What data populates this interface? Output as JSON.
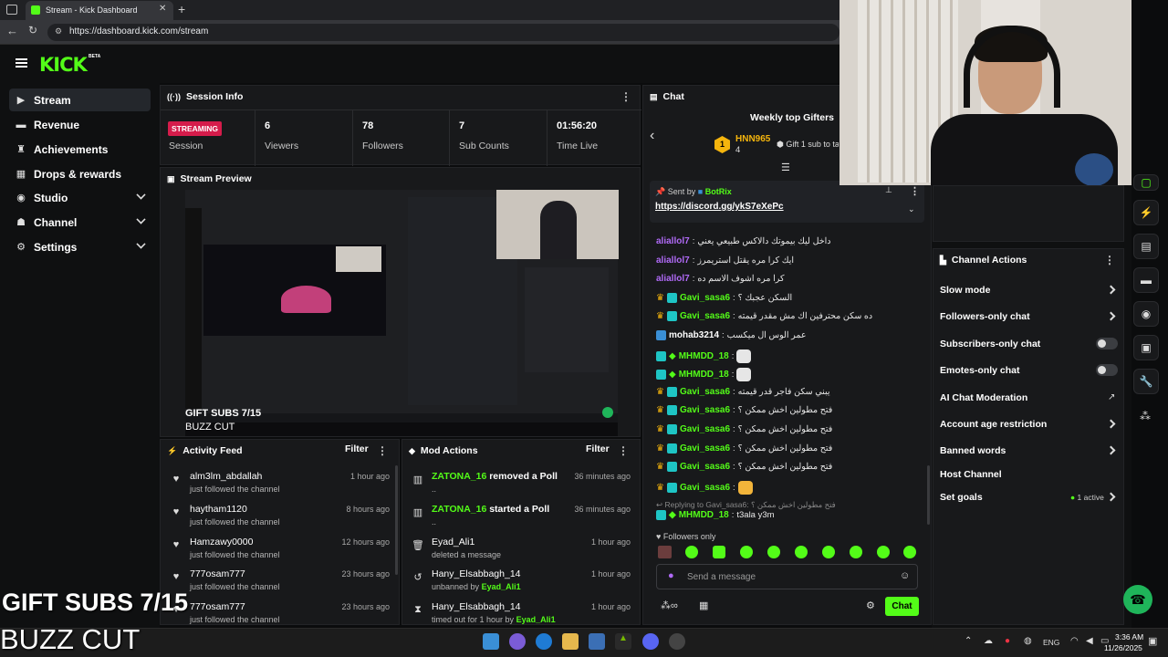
{
  "browser": {
    "tab_title": "Stream - Kick Dashboard",
    "url": "https://dashboard.kick.com/stream"
  },
  "header": {
    "logo": "KICK",
    "beta": "BETA"
  },
  "sidebar": {
    "items": [
      {
        "label": "Stream",
        "icon": "video-icon"
      },
      {
        "label": "Revenue",
        "icon": "money-icon"
      },
      {
        "label": "Achievements",
        "icon": "trophy-icon"
      },
      {
        "label": "Drops & rewards",
        "icon": "gift-icon"
      },
      {
        "label": "Studio",
        "icon": "studio-icon"
      },
      {
        "label": "Channel",
        "icon": "channel-icon"
      },
      {
        "label": "Settings",
        "icon": "gear-icon"
      }
    ]
  },
  "session": {
    "title": "Session Info",
    "status_badge": "STREAMING",
    "status_label": "Session",
    "stats": [
      {
        "value": "6",
        "label": "Viewers"
      },
      {
        "value": "78",
        "label": "Followers"
      },
      {
        "value": "7",
        "label": "Sub Counts"
      },
      {
        "value": "01:56:20",
        "label": "Time Live"
      }
    ]
  },
  "preview": {
    "title": "Stream Preview",
    "overlay_line1": "GIFT SUBS 7/15",
    "overlay_line2": "BUZZ CUT"
  },
  "activity": {
    "title": "Activity Feed",
    "filter": "Filter",
    "rows": [
      {
        "name": "alm3lm_abdallah",
        "sub": "just followed the channel",
        "time": "1 hour ago"
      },
      {
        "name": "haytham1120",
        "sub": "just followed the channel",
        "time": "8 hours ago"
      },
      {
        "name": "Hamzawy0000",
        "sub": "just followed the channel",
        "time": "12 hours ago"
      },
      {
        "name": "777osam777",
        "sub": "just followed the channel",
        "time": "23 hours ago"
      },
      {
        "name": "777osam777",
        "sub": "just followed the channel",
        "time": "23 hours ago"
      }
    ]
  },
  "mod": {
    "title": "Mod Actions",
    "filter": "Filter",
    "rows": [
      {
        "name": "ZATONA_16",
        "action": "removed a Poll",
        "sub": "..",
        "time": "36 minutes ago"
      },
      {
        "name": "ZATONA_16",
        "action": "started a Poll",
        "sub": "..",
        "time": "36 minutes ago"
      },
      {
        "name": "Eyad_Ali1",
        "action": "",
        "sub": "deleted a message",
        "time": "1 hour ago"
      },
      {
        "name": "Hany_Elsabbagh_14",
        "action": "",
        "sub": "unbanned by",
        "sub_user": "Eyad_Ali1",
        "time": "1 hour ago"
      },
      {
        "name": "Hany_Elsabbagh_14",
        "action": "",
        "sub": "timed out for 1 hour by",
        "sub_user": "Eyad_Ali1",
        "time": "1 hour ago"
      }
    ]
  },
  "chat": {
    "title": "Chat",
    "top_gifters_title": "Weekly top Gifters",
    "top_gifter": {
      "rank": "1",
      "name": "HNN965",
      "count": "4"
    },
    "gift_cta": "Gift 1 sub to ta",
    "pinned": {
      "sent_by": "Sent by",
      "user": "BotRix",
      "link": "https://discord.gg/ykS7eXePc"
    },
    "messages": [
      {
        "user": "aliallol7",
        "color": "pur",
        "text": "داخل ليك بيموتك دالاكس طبيعي يعني",
        "badges": []
      },
      {
        "user": "aliallol7",
        "color": "pur",
        "text": "ايك كرا مره يقتل استريمرز",
        "badges": []
      },
      {
        "user": "aliallol7",
        "color": "pur",
        "text": "كرا مره اشوف الاسم ده",
        "badges": []
      },
      {
        "user": "Gavi_sasa6",
        "color": "grn",
        "text": "السكن عجبك ؟",
        "badges": [
          "crown",
          "mod"
        ]
      },
      {
        "user": "Gavi_sasa6",
        "color": "grn",
        "text": "ده سكن محترفين اك مش مقدر قيمته",
        "badges": [
          "crown",
          "mod"
        ]
      },
      {
        "user": "mohab3214",
        "color": "wht",
        "text": "عمر الوس ال ميكسب",
        "badges": [
          "vip"
        ]
      },
      {
        "user": "MHMDD_18",
        "color": "grn",
        "text": "",
        "badges": [
          "mod",
          "diamond"
        ]
      },
      {
        "user": "MHMDD_18",
        "color": "grn",
        "text": "",
        "badges": [
          "mod",
          "diamond"
        ]
      },
      {
        "user": "Gavi_sasa6",
        "color": "grn",
        "text": "يبني سكن فاجر قدر قيمته",
        "badges": [
          "crown",
          "mod"
        ]
      },
      {
        "user": "Gavi_sasa6",
        "color": "grn",
        "text": "فتح مطولين اخش ممكن ؟",
        "badges": [
          "crown",
          "mod"
        ]
      },
      {
        "user": "Gavi_sasa6",
        "color": "grn",
        "text": "فتح مطولين اخش ممكن ؟",
        "badges": [
          "crown",
          "mod"
        ]
      },
      {
        "user": "Gavi_sasa6",
        "color": "grn",
        "text": "فتح مطولين اخش ممكن ؟",
        "badges": [
          "crown",
          "mod"
        ]
      },
      {
        "user": "Gavi_sasa6",
        "color": "grn",
        "text": "فتح مطولين اخش ممكن ؟",
        "badges": [
          "crown",
          "mod"
        ]
      },
      {
        "user": "Gavi_sasa6",
        "color": "grn",
        "text": "",
        "badges": [
          "crown",
          "mod"
        ]
      }
    ],
    "reply_to": "Replying to Gavi_sasa6:",
    "reply_text": "فتح مطولين اخش ممكن ؟",
    "reply_user": "MHMDD_18",
    "reply_msg": "t3ala y3m",
    "followers_only": "Followers only",
    "input_placeholder": "Send a message",
    "send": "Chat"
  },
  "channel_actions": {
    "title": "Channel Actions",
    "rows": [
      {
        "label": "Slow mode",
        "kind": "chevron"
      },
      {
        "label": "Followers-only chat",
        "kind": "chevron"
      },
      {
        "label": "Subscribers-only chat",
        "kind": "toggle"
      },
      {
        "label": "Emotes-only chat",
        "kind": "toggle"
      },
      {
        "label": "AI Chat Moderation",
        "kind": "external"
      },
      {
        "label": "Account age restriction",
        "kind": "chevron"
      },
      {
        "label": "Banned words",
        "kind": "chevron"
      },
      {
        "label": "Host Channel",
        "kind": "none"
      },
      {
        "label": "Set goals",
        "kind": "chevron"
      }
    ],
    "active_count": "1 active"
  },
  "taskbar": {
    "lang": "ENG",
    "time": "3:36 AM",
    "date": "11/26/2025"
  },
  "colors": {
    "accent": "#53fc18",
    "live": "#d51c4b",
    "panel": "#18191b"
  }
}
